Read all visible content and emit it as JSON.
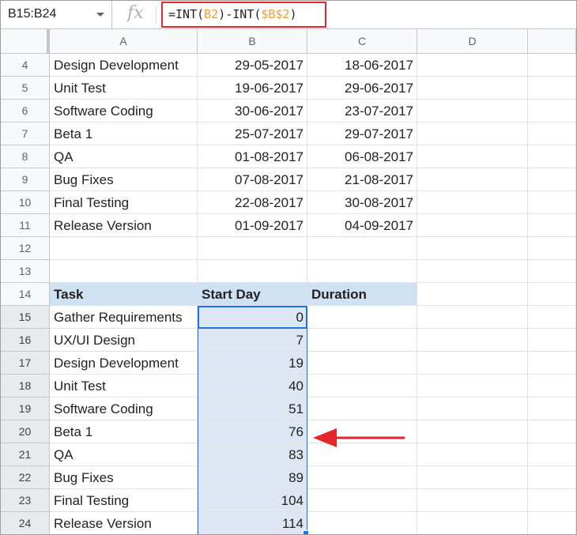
{
  "formula_bar": {
    "name_box": "B15:B24",
    "fx_label": "fx",
    "formula_parts": [
      "=INT(",
      "B2",
      ")-INT(",
      "$B$2",
      ")"
    ]
  },
  "columns": [
    "A",
    "B",
    "C",
    "D"
  ],
  "rows": [
    {
      "num": "4",
      "a": "Design Development",
      "b": "29-05-2017",
      "c": "18-06-2017"
    },
    {
      "num": "5",
      "a": "Unit Test",
      "b": "19-06-2017",
      "c": "29-06-2017"
    },
    {
      "num": "6",
      "a": "Software Coding",
      "b": "30-06-2017",
      "c": "23-07-2017"
    },
    {
      "num": "7",
      "a": "Beta 1",
      "b": "25-07-2017",
      "c": "29-07-2017"
    },
    {
      "num": "8",
      "a": "QA",
      "b": "01-08-2017",
      "c": "06-08-2017"
    },
    {
      "num": "9",
      "a": "Bug Fixes",
      "b": "07-08-2017",
      "c": "21-08-2017"
    },
    {
      "num": "10",
      "a": "Final Testing",
      "b": "22-08-2017",
      "c": "30-08-2017"
    },
    {
      "num": "11",
      "a": "Release Version",
      "b": "01-09-2017",
      "c": "04-09-2017"
    },
    {
      "num": "12",
      "a": "",
      "b": "",
      "c": ""
    },
    {
      "num": "13",
      "a": "",
      "b": "",
      "c": ""
    },
    {
      "num": "14",
      "a": "Task",
      "b": "Start Day",
      "c": "Duration",
      "header": true
    },
    {
      "num": "15",
      "a": "Gather Requirements",
      "b": "0",
      "c": "",
      "selected": true
    },
    {
      "num": "16",
      "a": "UX/UI Design",
      "b": "7",
      "c": "",
      "selected": true
    },
    {
      "num": "17",
      "a": "Design Development",
      "b": "19",
      "c": "",
      "selected": true
    },
    {
      "num": "18",
      "a": "Unit Test",
      "b": "40",
      "c": "",
      "selected": true
    },
    {
      "num": "19",
      "a": "Software Coding",
      "b": "51",
      "c": "",
      "selected": true
    },
    {
      "num": "20",
      "a": "Beta 1",
      "b": "76",
      "c": "",
      "selected": true
    },
    {
      "num": "21",
      "a": "QA",
      "b": "83",
      "c": "",
      "selected": true
    },
    {
      "num": "22",
      "a": "Bug Fixes",
      "b": "89",
      "c": "",
      "selected": true
    },
    {
      "num": "23",
      "a": "Final Testing",
      "b": "104",
      "c": "",
      "selected": true
    },
    {
      "num": "24",
      "a": "Release Version",
      "b": "114",
      "c": "",
      "selected": true
    }
  ],
  "colors": {
    "formula_highlight": "#e3262a",
    "ref_orange": "#f39c34",
    "header_fill": "#cfe2f3",
    "selection_fill": "#dde6f2",
    "selection_border": "#1a73e8",
    "arrow": "#e3262a"
  },
  "icons": {
    "name_box_dropdown": "chevron-down-icon",
    "annotation": "arrow-left-icon"
  }
}
